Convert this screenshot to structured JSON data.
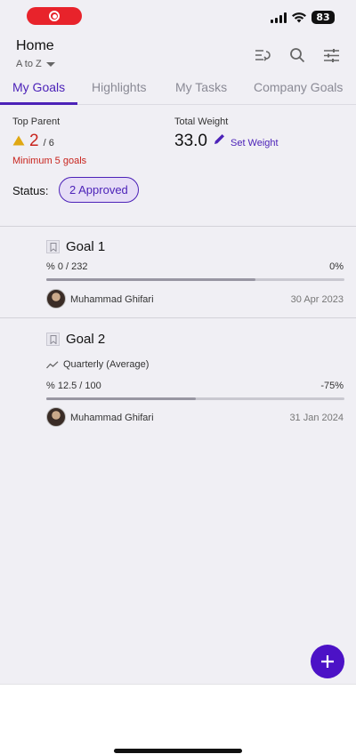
{
  "statusbar": {
    "battery": "83"
  },
  "header": {
    "title": "Home",
    "sort_label": "A to Z"
  },
  "tabs": [
    {
      "label": "My Goals",
      "active": true
    },
    {
      "label": "Highlights",
      "active": false
    },
    {
      "label": "My Tasks",
      "active": false
    },
    {
      "label": "Company Goals",
      "active": false
    }
  ],
  "summary": {
    "top_parent_label": "Top Parent",
    "top_parent_value": "2",
    "top_parent_of": "/ 6",
    "min_goals_warning": "Minimum 5 goals",
    "total_weight_label": "Total Weight",
    "total_weight_value": "33.0",
    "set_weight_label": "Set Weight",
    "status_label": "Status:",
    "status_badge": "2 Approved"
  },
  "goals": [
    {
      "title": "Goal 1",
      "progress_text": "% 0 / 232",
      "progress_percent": "0%",
      "progress_fraction": 0.7,
      "owner": "Muhammad Ghifari",
      "date": "30 Apr 2023"
    },
    {
      "title": "Goal 2",
      "period": "Quarterly (Average)",
      "progress_text": "% 12.5 / 100",
      "progress_percent": "-75%",
      "progress_fraction": 0.5,
      "owner": "Muhammad Ghifari",
      "date": "31 Jan 2024"
    }
  ],
  "colors": {
    "accent": "#4c22b8",
    "warning": "#c8241d",
    "fab": "#4c12c6"
  }
}
